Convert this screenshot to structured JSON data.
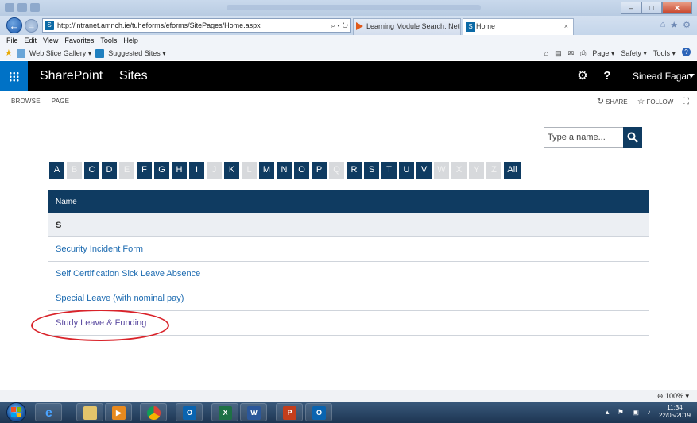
{
  "browser": {
    "address": "http://intranet.amnch.ie/tuheforms/eforms/SitePages/Home.aspx",
    "address_actions": "⌕ ▾ ↻",
    "tabs": [
      {
        "label": "Learning Module Search: NetD..."
      },
      {
        "label": "Home",
        "close": "×"
      }
    ],
    "menu": [
      "File",
      "Edit",
      "View",
      "Favorites",
      "Tools",
      "Help"
    ],
    "favorites": [
      "Web Slice Gallery ▾",
      "Suggested Sites ▾"
    ],
    "command_bar": [
      "Page ▾",
      "Safety ▾",
      "Tools ▾"
    ],
    "zoom": "⊕ 100%  ▾"
  },
  "suite": {
    "brand": "SharePoint",
    "sites": "Sites",
    "user": "Sinead Fagan"
  },
  "ribbon": {
    "tabs": [
      "BROWSE",
      "PAGE"
    ],
    "share": "SHARE",
    "follow": "FOLLOW"
  },
  "search": {
    "placeholder": "Type a name..."
  },
  "alphabet": [
    {
      "letter": "A",
      "enabled": true
    },
    {
      "letter": "B",
      "enabled": false
    },
    {
      "letter": "C",
      "enabled": true
    },
    {
      "letter": "D",
      "enabled": true
    },
    {
      "letter": "E",
      "enabled": false
    },
    {
      "letter": "F",
      "enabled": true
    },
    {
      "letter": "G",
      "enabled": true
    },
    {
      "letter": "H",
      "enabled": true
    },
    {
      "letter": "I",
      "enabled": true
    },
    {
      "letter": "J",
      "enabled": false
    },
    {
      "letter": "K",
      "enabled": true
    },
    {
      "letter": "L",
      "enabled": false
    },
    {
      "letter": "M",
      "enabled": true
    },
    {
      "letter": "N",
      "enabled": true
    },
    {
      "letter": "O",
      "enabled": true
    },
    {
      "letter": "P",
      "enabled": true
    },
    {
      "letter": "Q",
      "enabled": false
    },
    {
      "letter": "R",
      "enabled": true
    },
    {
      "letter": "S",
      "enabled": true
    },
    {
      "letter": "T",
      "enabled": true
    },
    {
      "letter": "U",
      "enabled": true
    },
    {
      "letter": "V",
      "enabled": true
    },
    {
      "letter": "W",
      "enabled": false
    },
    {
      "letter": "X",
      "enabled": false
    },
    {
      "letter": "Y",
      "enabled": false
    },
    {
      "letter": "Z",
      "enabled": false
    },
    {
      "letter": "All",
      "enabled": true
    }
  ],
  "table": {
    "header": "Name",
    "group": "S",
    "rows": [
      {
        "label": "Security Incident Form"
      },
      {
        "label": "Self Certification Sick Leave Absence"
      },
      {
        "label": "Special Leave (with nominal pay)"
      },
      {
        "label": "Study Leave & Funding"
      }
    ]
  },
  "taskbar": {
    "clock_time": "11:34",
    "clock_date": "22/05/2019"
  },
  "colors": {
    "suite_bar": "#000000",
    "waffle": "#0072c6",
    "navy": "#0f3b61",
    "link": "#1b6ab0",
    "highlight": "#d9232a"
  }
}
